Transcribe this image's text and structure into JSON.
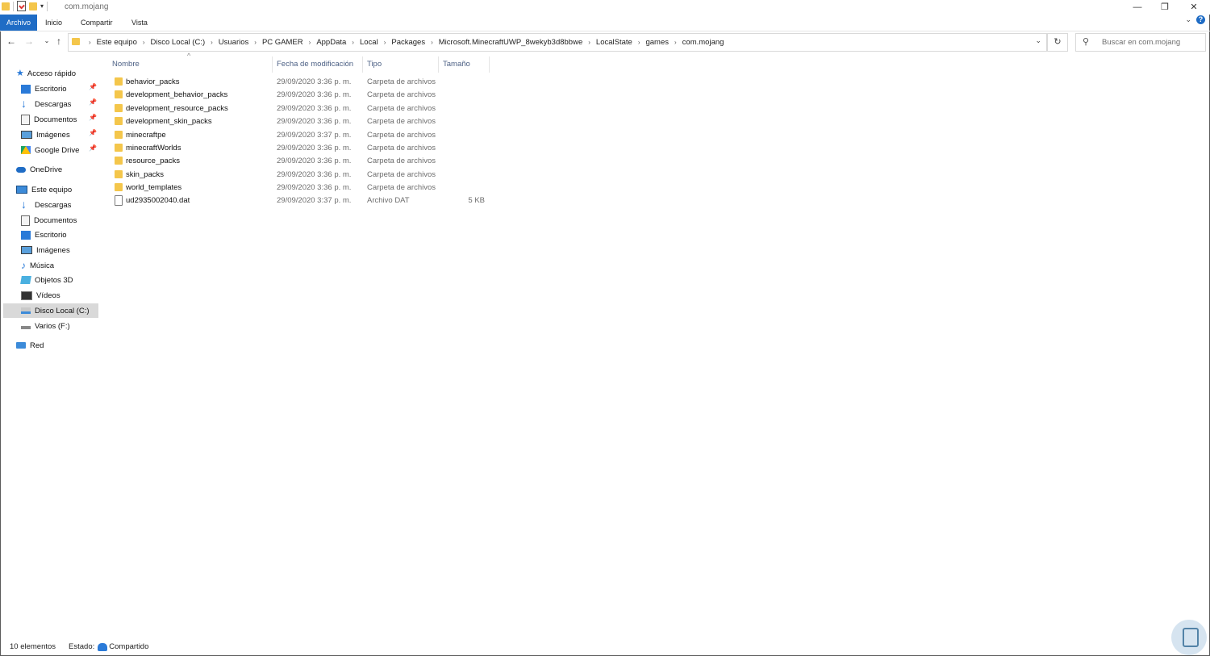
{
  "window": {
    "title": "com.mojang",
    "minimize": "—",
    "maximize": "❐",
    "close": "✕"
  },
  "ribbon": {
    "tabs": [
      "Archivo",
      "Inicio",
      "Compartir",
      "Vista"
    ],
    "help": "?"
  },
  "address": {
    "breadcrumbs": [
      "Este equipo",
      "Disco Local (C:)",
      "Usuarios",
      "PC GAMER",
      "AppData",
      "Local",
      "Packages",
      "Microsoft.MinecraftUWP_8wekyb3d8bbwe",
      "LocalState",
      "games",
      "com.mojang"
    ],
    "search_placeholder": "Buscar en com.mojang"
  },
  "sidebar": {
    "quick_access": "Acceso rápido",
    "quick_items": [
      "Escritorio",
      "Descargas",
      "Documentos",
      "Imágenes",
      "Google Drive"
    ],
    "onedrive": "OneDrive",
    "this_pc": "Este equipo",
    "pc_items": [
      "Descargas",
      "Documentos",
      "Escritorio",
      "Imágenes",
      "Música",
      "Objetos 3D",
      "Vídeos",
      "Disco Local (C:)",
      "Varios (F:)"
    ],
    "network": "Red"
  },
  "columns": {
    "name": "Nombre",
    "date": "Fecha de modificación",
    "type": "Tipo",
    "size": "Tamaño"
  },
  "files": [
    {
      "name": "behavior_packs",
      "date": "29/09/2020 3:36 p. m.",
      "type": "Carpeta de archivos",
      "size": ""
    },
    {
      "name": "development_behavior_packs",
      "date": "29/09/2020 3:36 p. m.",
      "type": "Carpeta de archivos",
      "size": ""
    },
    {
      "name": "development_resource_packs",
      "date": "29/09/2020 3:36 p. m.",
      "type": "Carpeta de archivos",
      "size": ""
    },
    {
      "name": "development_skin_packs",
      "date": "29/09/2020 3:36 p. m.",
      "type": "Carpeta de archivos",
      "size": ""
    },
    {
      "name": "minecraftpe",
      "date": "29/09/2020 3:37 p. m.",
      "type": "Carpeta de archivos",
      "size": ""
    },
    {
      "name": "minecraftWorlds",
      "date": "29/09/2020 3:36 p. m.",
      "type": "Carpeta de archivos",
      "size": ""
    },
    {
      "name": "resource_packs",
      "date": "29/09/2020 3:36 p. m.",
      "type": "Carpeta de archivos",
      "size": ""
    },
    {
      "name": "skin_packs",
      "date": "29/09/2020 3:36 p. m.",
      "type": "Carpeta de archivos",
      "size": ""
    },
    {
      "name": "world_templates",
      "date": "29/09/2020 3:36 p. m.",
      "type": "Carpeta de archivos",
      "size": ""
    },
    {
      "name": "ud2935002040.dat",
      "date": "29/09/2020 3:37 p. m.",
      "type": "Archivo DAT",
      "size": "5 KB"
    }
  ],
  "status": {
    "count": "10 elementos",
    "state_label": "Estado:",
    "state_value": "Compartido"
  },
  "colors": {
    "accent": "#1f6cc5",
    "folder": "#f4c64b",
    "header_text": "#4d6185"
  }
}
